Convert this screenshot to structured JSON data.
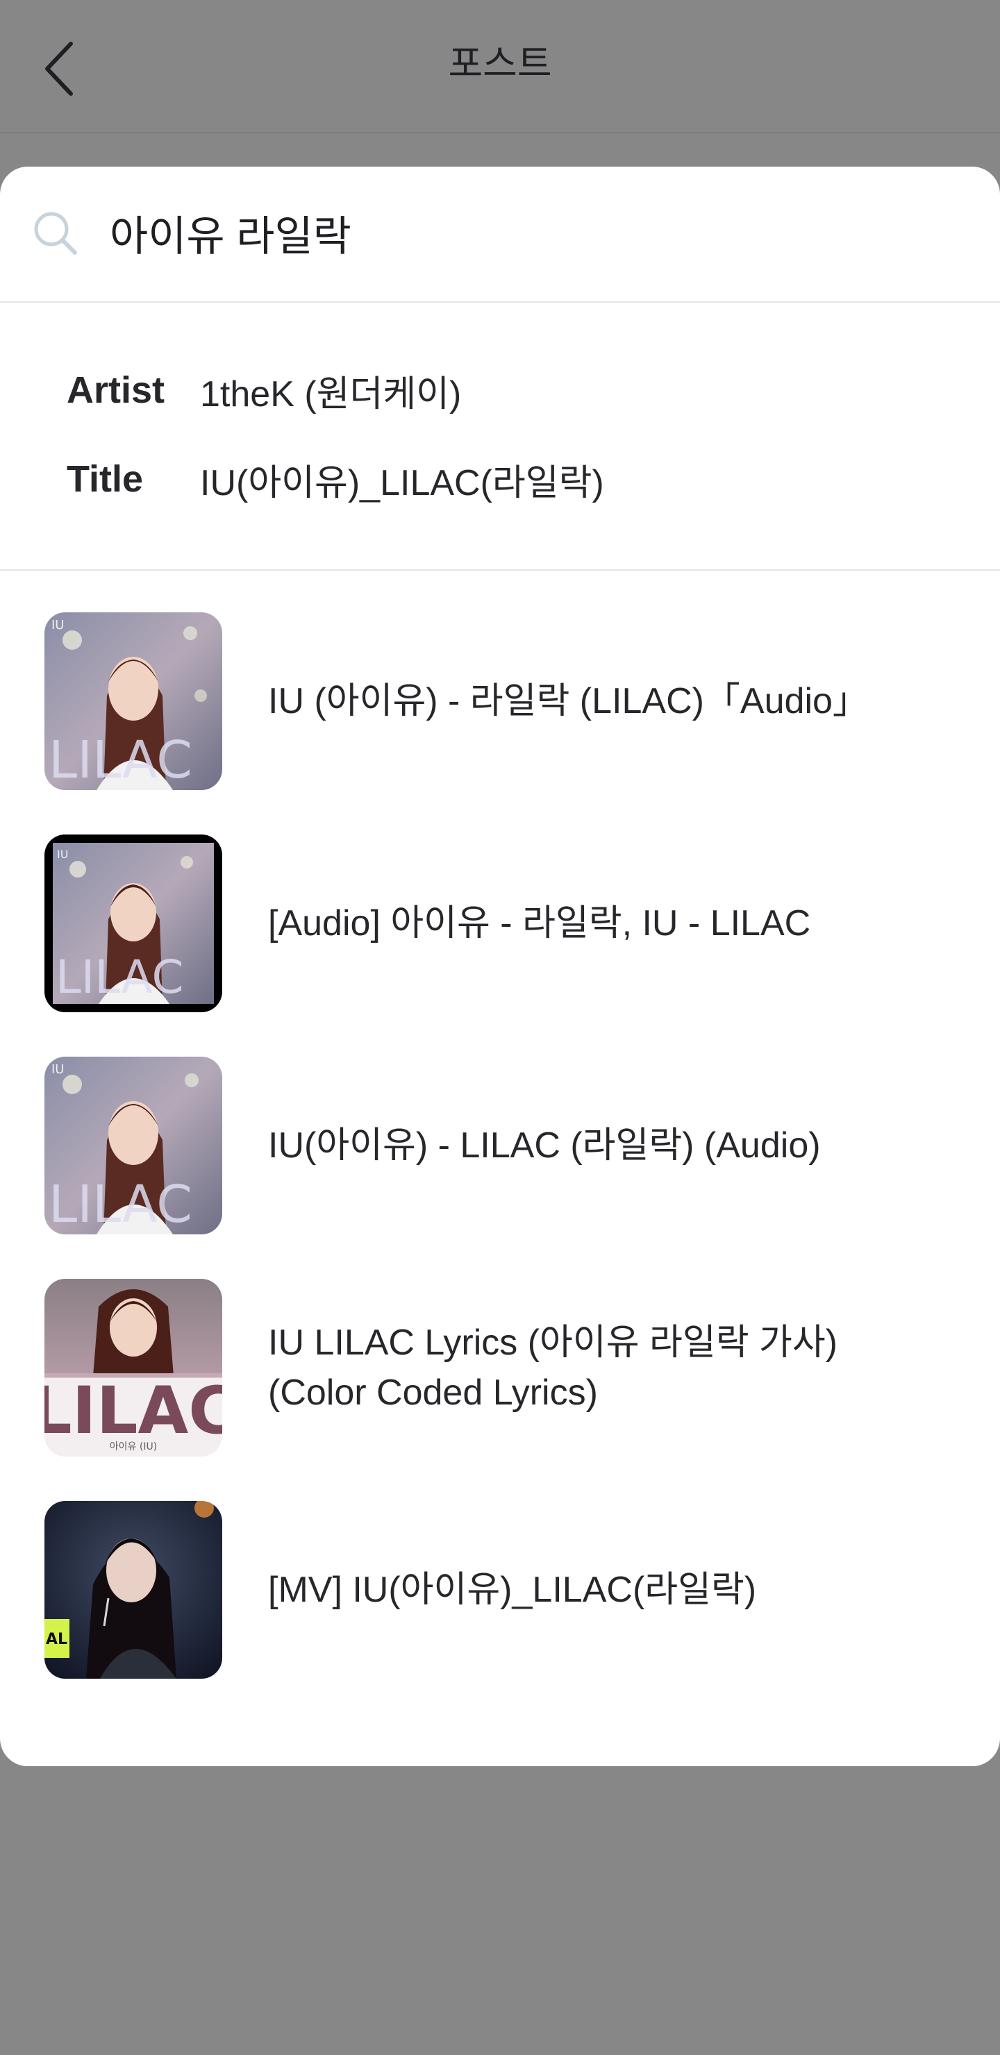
{
  "header": {
    "title": "포스트",
    "back_icon": "chevron-left-icon"
  },
  "search": {
    "query": "아이유 라일락",
    "icon": "search-icon"
  },
  "metadata": {
    "artist_label": "Artist",
    "artist_value": "1theK (원더케이)",
    "title_label": "Title",
    "title_value": "IU(아이유)_LILAC(라일락)"
  },
  "results": [
    {
      "title": "IU (아이유) - 라일락 (LILAC)「Audio」",
      "thumbnail_text": "LILAC",
      "thumbnail_sub": "IU"
    },
    {
      "title": "[Audio] 아이유 - 라일락, IU - LILAC",
      "thumbnail_text": "LILAC",
      "thumbnail_sub": "IU"
    },
    {
      "title": "IU(아이유) - LILAC (라일락) (Audio)",
      "thumbnail_text": "LILAC",
      "thumbnail_sub": "IU"
    },
    {
      "title": "IU LILAC Lyrics (아이유 라일락 가사) (Color Coded Lyrics)",
      "thumbnail_text": "LILAC",
      "thumbnail_sub": "아이유 (IU)"
    },
    {
      "title": "[MV] IU(아이유)_LILAC(라일락)",
      "thumbnail_text": "AL",
      "thumbnail_sub": ""
    }
  ],
  "colors": {
    "overlay": "#878787",
    "sheet": "#ffffff",
    "text": "#1e1f23",
    "divider": "#e2e4e8",
    "search_icon": "#c7d3dc"
  }
}
